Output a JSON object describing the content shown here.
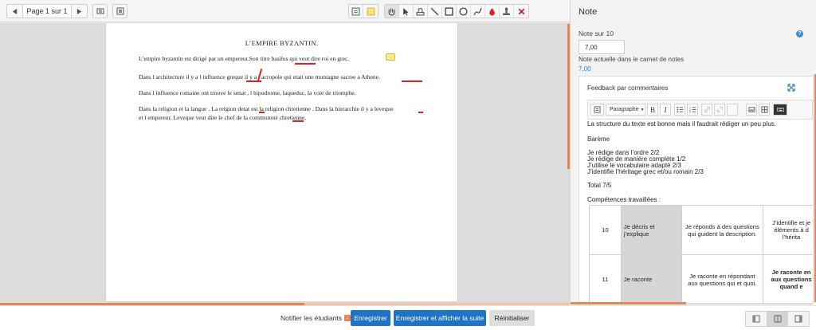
{
  "toolbar": {
    "page_indicator": "Page 1 sur 1"
  },
  "document": {
    "title": "L’EMPIRE BYZANTIN.",
    "lines": [
      "L’empire byzantin est dirigé par un empereur.Son titre basilus qui veut dire roi en grec.",
      "Dans l architecture il y a l influence greque il y a l acropole qui etait une montagne sacree a Athene.",
      "Dans l influence romaine ont trouve le senat , l hipodrome, laqueduc, la voie de triomphe.",
      "Dans la religion et la langue . La relgion detat est la religion chretienne . Dans la hierarchie il y a leveque",
      "et l empereur. Leveque veut dire le chef de la communoté chretienne."
    ]
  },
  "panel": {
    "title": "Note",
    "grade_label": "Note sur 10",
    "grade_value": "7,00",
    "gradebook_label": "Note actuelle dans le carnet de notes",
    "gradebook_value": "7,00",
    "feedback_title": "Feedback par commentaires",
    "format_select": "Paragraphe",
    "bold_label": "B",
    "italic_label": "I",
    "content": {
      "intro": "La structure du texte est bonne mais il faudrait rédiger un peu plus.",
      "bareme_heading": "Barème",
      "bareme_items": [
        "Je rédige dans l’ordre 2/2",
        "Je rédige de manière complète 1/2",
        "J’utilise le vocabulaire adapté 2/3",
        "J’identifie l’héritage grec et/ou romain 2/3"
      ],
      "total": "Total 7/5",
      "competences_heading": "Compétences travaillées :"
    },
    "rubric": [
      {
        "number": "10",
        "skill": "Je décris et j’explique",
        "criterion_1": "Je réponds à des questions qui guident la description.",
        "criterion_2": "J’identifie et je éléments à d l’hérita"
      },
      {
        "number": "11",
        "skill": "Je raconte",
        "criterion_1": "Je raconte en répondant aux questions qui et quoi.",
        "criterion_2": "Je raconte en aux questions quand e"
      }
    ]
  },
  "footer": {
    "notify_label": "Notifier les étudiants",
    "save_label": "Enregistrer",
    "save_next_label": "Enregistrer et afficher la suite",
    "reset_label": "Réinitialiser"
  },
  "colors": {
    "accent": "#ee8255",
    "primary_button": "#1f73c7",
    "annotation_red": "#e02020",
    "link_blue": "#2b7bc4"
  },
  "icons": [
    "arrow-left-icon",
    "arrow-right-icon",
    "thumbnails-icon",
    "expand-icon",
    "comment-tool-icon",
    "highlight-tool-icon",
    "hand-tool-icon",
    "select-tool-icon",
    "stamp-comment-icon",
    "line-tool-icon",
    "rectangle-tool-icon",
    "oval-tool-icon",
    "pen-tool-icon",
    "color-drop-icon",
    "stamp-tool-icon",
    "delete-icon"
  ]
}
